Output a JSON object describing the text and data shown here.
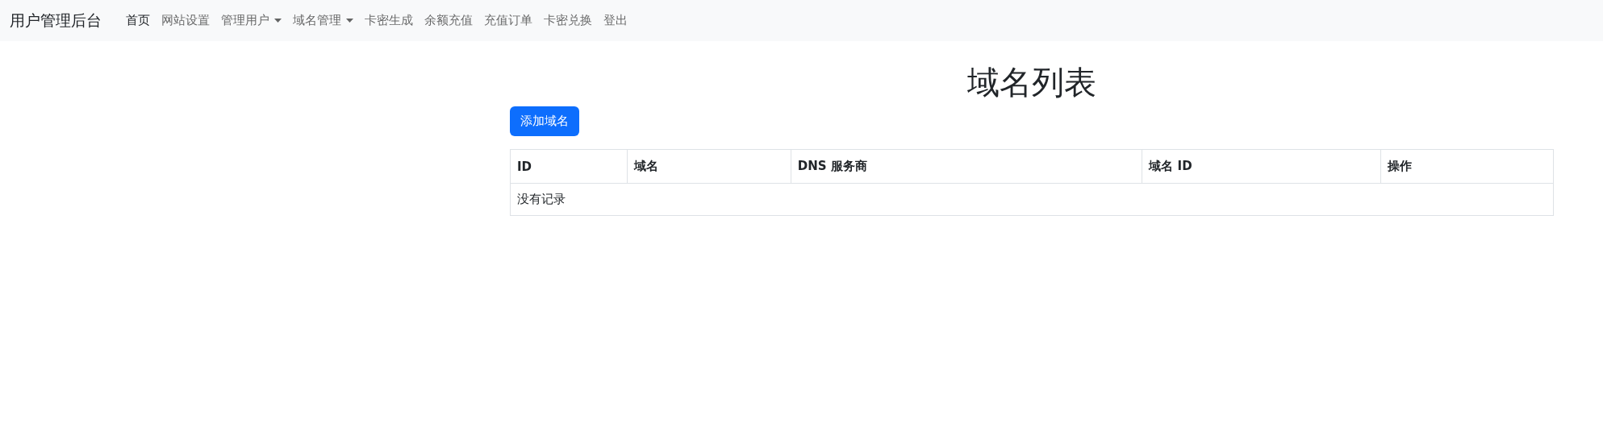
{
  "navbar": {
    "brand": "用户管理后台",
    "items": [
      {
        "label": "首页",
        "selected": true,
        "kind": "link"
      },
      {
        "label": "网站设置",
        "selected": false,
        "kind": "link"
      },
      {
        "label": "管理用户",
        "selected": false,
        "kind": "dropdown"
      },
      {
        "label": "域名管理",
        "selected": false,
        "kind": "dropdown"
      },
      {
        "label": "卡密生成",
        "selected": false,
        "kind": "link"
      },
      {
        "label": "余额充值",
        "selected": false,
        "kind": "link"
      },
      {
        "label": "充值订单",
        "selected": false,
        "kind": "link"
      },
      {
        "label": "卡密兑换",
        "selected": false,
        "kind": "link"
      },
      {
        "label": "登出",
        "selected": false,
        "kind": "link"
      }
    ]
  },
  "page": {
    "title": "域名列表",
    "add_button": "添加域名"
  },
  "table": {
    "columns": [
      "ID",
      "域名",
      "DNS 服务商",
      "域名 ID",
      "操作"
    ],
    "empty_message": "没有记录"
  }
}
